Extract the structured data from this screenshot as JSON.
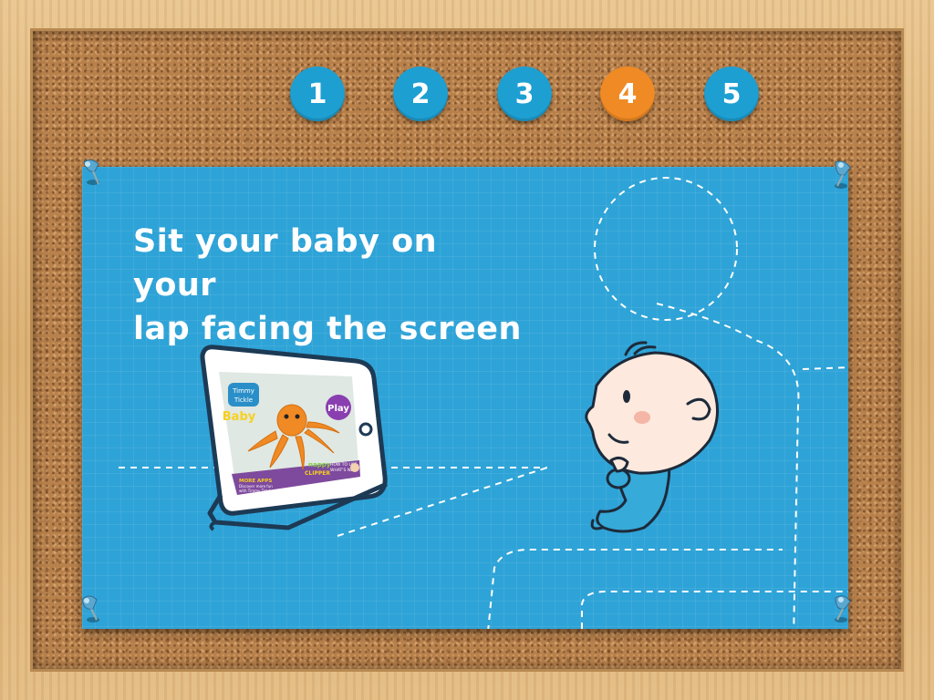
{
  "steps": [
    {
      "label": "1",
      "active": false
    },
    {
      "label": "2",
      "active": false
    },
    {
      "label": "3",
      "active": false
    },
    {
      "label": "4",
      "active": true
    },
    {
      "label": "5",
      "active": false
    }
  ],
  "instruction": {
    "line1": "Sit your baby on your",
    "line2": "lap facing the screen"
  },
  "tablet_screen": {
    "logo_line1": "Timmy",
    "logo_line2": "Tickle",
    "logo_word": "Baby",
    "play_label": "Play",
    "more_apps_label": "MORE APPS",
    "more_apps_sub1": "Discover more fun",
    "more_apps_sub2": "with Timmy Tickle",
    "nappy_label": "nappy",
    "clipper_label": "CLIPPER",
    "howto_line1": "HOW TO USE",
    "howto_line2": "WHAT'S NEW"
  },
  "colors": {
    "step_default": "#1e9fd2",
    "step_active": "#f08a24",
    "sheet": "#2ea3d7",
    "octopus": "#f08a24"
  },
  "icons": [
    "pushpin-icon",
    "tablet-illustration",
    "baby-illustration",
    "chair-outline"
  ]
}
